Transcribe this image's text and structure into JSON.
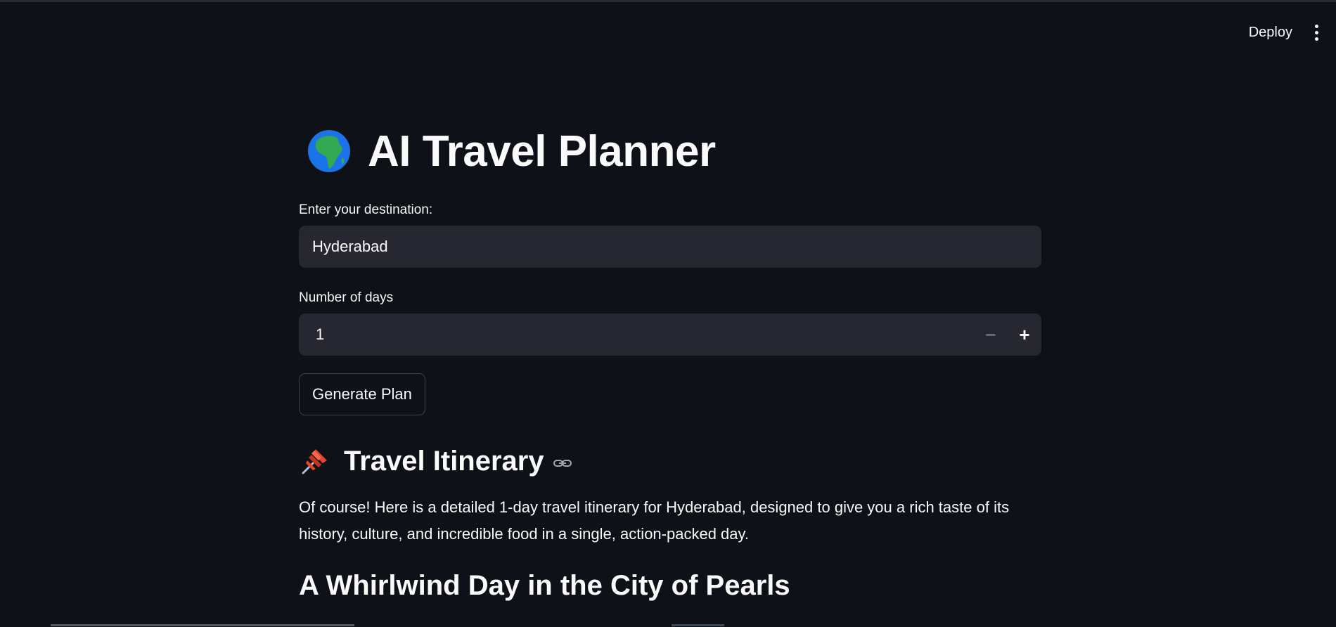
{
  "header": {
    "deploy_label": "Deploy"
  },
  "app": {
    "title": "AI Travel Planner"
  },
  "form": {
    "destination_label": "Enter your destination:",
    "destination_value": "Hyderabad",
    "days_label": "Number of days",
    "days_value": "1",
    "minus_symbol": "−",
    "plus_symbol": "+",
    "generate_label": "Generate Plan"
  },
  "itinerary": {
    "heading": "Travel Itinerary",
    "intro": "Of course! Here is a detailed 1-day travel itinerary for Hyderabad, designed to give you a rich taste of its history, culture, and incredible food in a single, action-packed day.",
    "subheading": "A Whirlwind Day in the City of Pearls"
  },
  "icons": {
    "title_icon": "globe-africa-icon",
    "section_icon": "pushpin-icon",
    "anchor_icon": "link-icon",
    "menu_icon": "vertical-ellipsis-icon"
  },
  "colors": {
    "background": "#0e1117",
    "input_bg": "#262730",
    "text": "#fafafa",
    "globe_ocean": "#1a73e8",
    "globe_land": "#34a853",
    "pin_red": "#e8452c"
  }
}
